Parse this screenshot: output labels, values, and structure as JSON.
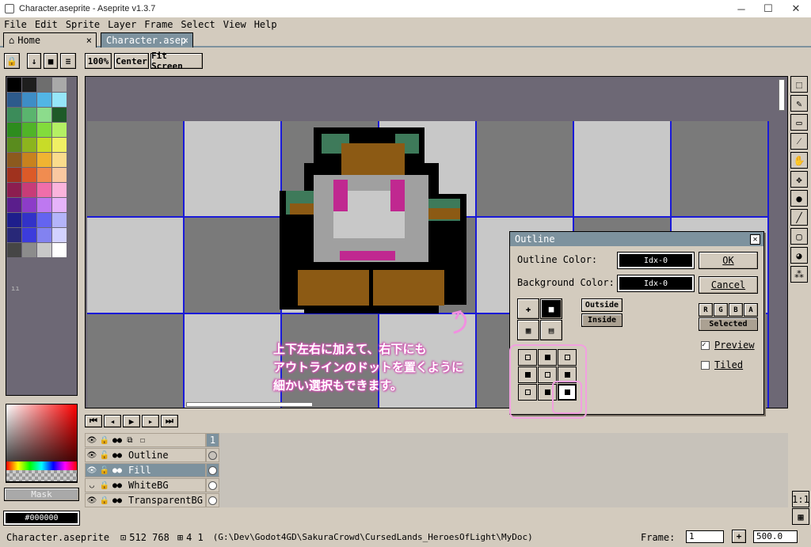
{
  "window": {
    "title": "Character.aseprite - Aseprite v1.3.7"
  },
  "menu": [
    "File",
    "Edit",
    "Sprite",
    "Layer",
    "Frame",
    "Select",
    "View",
    "Help"
  ],
  "tabs": [
    {
      "label": "Home",
      "close": "×"
    },
    {
      "label": "Character.asep",
      "close": "×"
    }
  ],
  "toolbar": {
    "zoom": "100%",
    "center": "Center",
    "fit": "Fit Screen"
  },
  "palette_colors": [
    "#000000",
    "#1e1e1e",
    "#6e6e6e",
    "#a9a9a9",
    "#2d5a8c",
    "#3e8dc6",
    "#52b5e6",
    "#96e6fa",
    "#3c8c5a",
    "#5ab46e",
    "#8cdc8c",
    "#1e5a28",
    "#2d8c1e",
    "#50b428",
    "#82dc3c",
    "#b4f064",
    "#5a8c1e",
    "#8cb41e",
    "#c8dc28",
    "#f0f064",
    "#8c5a1e",
    "#c8821e",
    "#f0b432",
    "#fadc8c",
    "#a0321e",
    "#dc5a28",
    "#f08c50",
    "#fac8a0",
    "#8c1e50",
    "#c83c78",
    "#f06eaa",
    "#fab4dc",
    "#5a1e8c",
    "#8c3cc8",
    "#be78f0",
    "#e6b4fa",
    "#1e1e8c",
    "#3232c8",
    "#6464f0",
    "#b4b4fa",
    "#282878",
    "#3c3cdc",
    "#8282f0",
    "#d2d2ff",
    "#464646",
    "#8c8c8c",
    "#c8c8c8",
    "#ffffff"
  ],
  "colorbar": {
    "mask": "Mask",
    "hex": "#000000"
  },
  "layers": [
    {
      "name": "Outline"
    },
    {
      "name": "Fill"
    },
    {
      "name": "WhiteBG"
    },
    {
      "name": "TransparentBG"
    }
  ],
  "frame_header": "1",
  "dialog": {
    "title": "Outline",
    "outline_color_label": "Outline Color:",
    "outline_color_value": "Idx-0",
    "bg_color_label": "Background Color:",
    "bg_color_value": "Idx-0",
    "ok": "OK",
    "cancel": "Cancel",
    "outside": "Outside",
    "inside": "Inside",
    "rgba": [
      "R",
      "G",
      "B",
      "A"
    ],
    "selected": "Selected",
    "preview": "Preview",
    "tiled": "Tiled"
  },
  "annotation": {
    "line1": "上下左右に加えて、右下にも",
    "line2": "アウトラインのドットを置くように",
    "line3": "細かい選択もできます。"
  },
  "status": {
    "file": "Character.aseprite",
    "size": "512 768",
    "grid": "4 1",
    "path": "(G:\\Dev\\Godot4GD\\SakuraCrowd\\CursedLands_HeroesOfLight\\MyDoc)",
    "frame_label": "Frame:",
    "frame_value": "1",
    "zoom_value": "500.0"
  },
  "scale": "1:1"
}
